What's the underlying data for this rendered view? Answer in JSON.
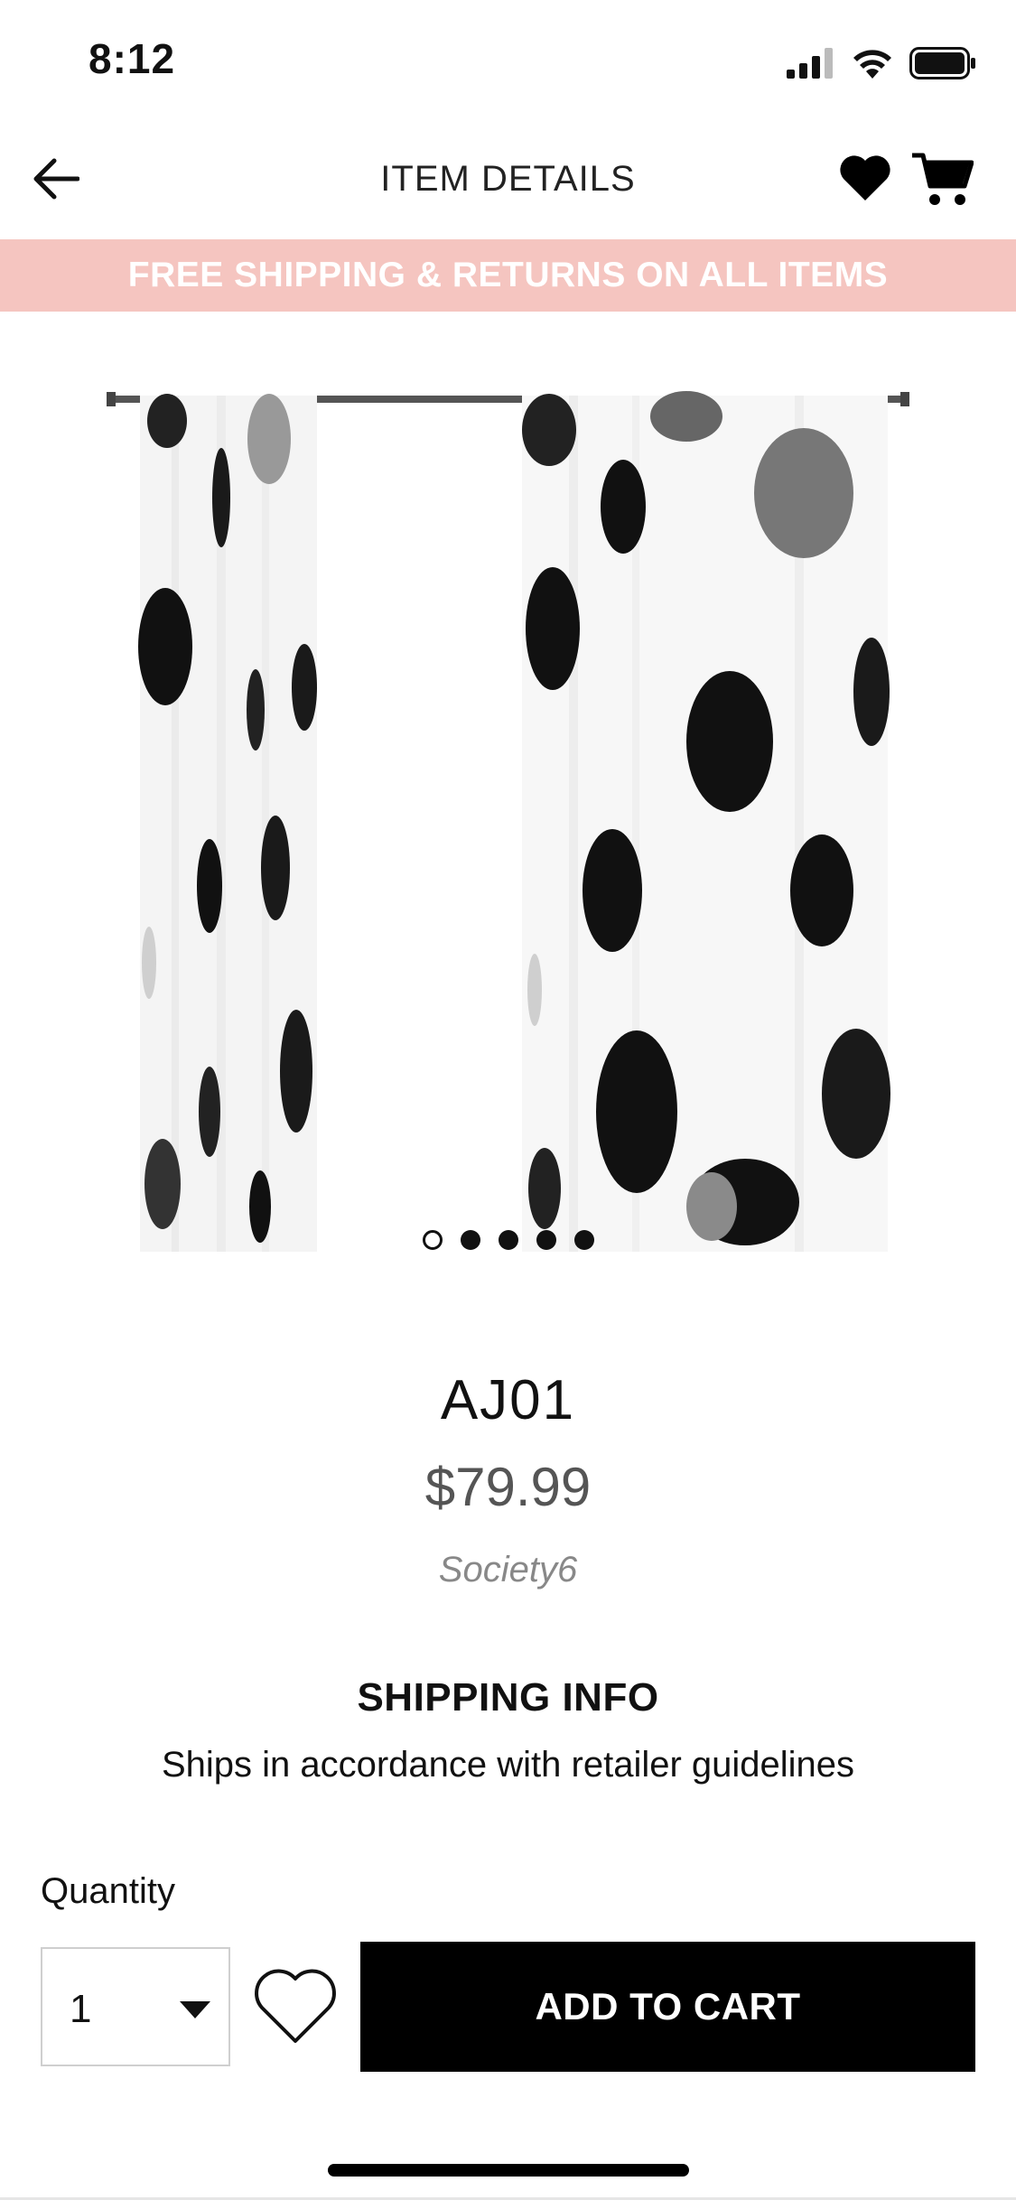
{
  "status_bar": {
    "time": "8:12",
    "icons": [
      "cellular-signal-icon",
      "wifi-icon",
      "battery-icon"
    ]
  },
  "nav": {
    "title": "ITEM DETAILS",
    "back_icon": "back-arrow-icon",
    "favorites_icon": "heart-icon",
    "cart_icon": "cart-icon"
  },
  "promo": {
    "text": "FREE SHIPPING & RETURNS ON ALL ITEMS",
    "background": "#f5c5c0"
  },
  "gallery": {
    "image_description_icon": "curtains-image",
    "page_count": 5,
    "active_page": 1
  },
  "product": {
    "name": "AJ01",
    "price": "$79.99",
    "brand": "Society6"
  },
  "shipping": {
    "title": "SHIPPING INFO",
    "text": "Ships in accordance with retailer guidelines"
  },
  "purchase": {
    "quantity_label": "Quantity",
    "quantity_value": "1",
    "add_to_cart_label": "ADD TO CART",
    "wishlist_icon": "heart-outline-icon",
    "button_color": "#000000"
  }
}
